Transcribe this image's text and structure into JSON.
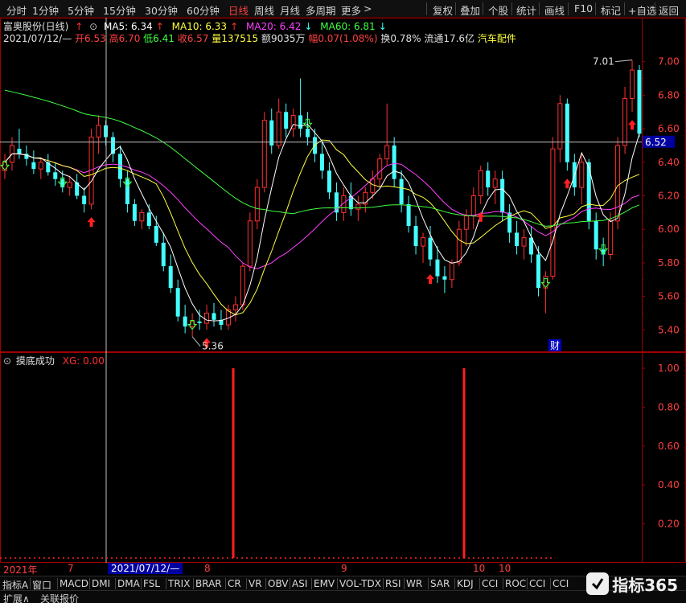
{
  "colors": {
    "up": "#ff3030",
    "down": "#44ffff",
    "ma5": "#ffffff",
    "ma10": "#ffff40",
    "ma20": "#ff40ff",
    "ma60": "#40ff40",
    "axis": "#a00000",
    "signal": "#ff2020"
  },
  "toolbar": {
    "periods": [
      "分时",
      "1分钟",
      "5分钟",
      "15分钟",
      "30分钟",
      "60分钟",
      "日线",
      "周线",
      "月线",
      "多周期",
      "更多"
    ],
    "active_period": "日线",
    "buttons": [
      "复权",
      "叠加",
      "个股",
      "统计",
      "画线",
      "F10",
      "标记",
      "+自选",
      "返回"
    ]
  },
  "main": {
    "stock_title": "富奥股份(日线)",
    "ma5_label": "MA5: 6.34",
    "ma10_label": "MA10: 6.33",
    "ma20_label": "MA20: 6.42",
    "ma60_label": "MA60: 6.81",
    "date": "2021/07/12/—",
    "open": "开6.53",
    "high": "高6.70",
    "low": "低6.41",
    "close": "收6.57",
    "volume": "量137515",
    "amount": "额9035万",
    "change": "幅0.07(1.08%)",
    "turnover": "换0.78%",
    "float_cap": "流通17.6亿",
    "sector": "汽车配件",
    "high_mark": "7.01",
    "low_mark": "5.36",
    "current_price": "6.52",
    "cai_badge": "财",
    "y_ticks": [
      "7.00",
      "6.80",
      "6.60",
      "6.40",
      "6.20",
      "6.00",
      "5.80",
      "5.60",
      "5.40"
    ]
  },
  "sub": {
    "indicator_name": "摸底成功",
    "xg_label": "XG: 0.00",
    "y_ticks": [
      "1.00",
      "0.80",
      "0.60",
      "0.40",
      "0.20",
      "0.00"
    ]
  },
  "x_axis": {
    "labels": [
      "2021年",
      "7",
      "2021/07/12/—",
      "8",
      "9",
      "10",
      "10"
    ]
  },
  "indicator_tabs": [
    "指标A",
    "窗口",
    "MACD",
    "DMI",
    "DMA",
    "FSL",
    "TRIX",
    "BRAR",
    "CR",
    "VR",
    "OBV",
    "ASI",
    "EMV",
    "VOL-TDX",
    "RSI",
    "WR",
    "SAR",
    "KDJ",
    "CCI",
    "ROC",
    "CCI",
    "CCI"
  ],
  "bottom_bar": {
    "expand": "扩展∧",
    "related": "关联报价"
  },
  "watermark": "指标365",
  "chart_data": {
    "type": "candlestick",
    "ylim": [
      5.32,
      7.08
    ],
    "candles": [
      [
        6.35,
        6.45,
        6.3,
        6.4
      ],
      [
        6.4,
        6.55,
        6.35,
        6.5
      ],
      [
        6.48,
        6.6,
        6.42,
        6.45
      ],
      [
        6.45,
        6.5,
        6.38,
        6.42
      ],
      [
        6.4,
        6.47,
        6.33,
        6.36
      ],
      [
        6.36,
        6.42,
        6.3,
        6.4
      ],
      [
        6.4,
        6.45,
        6.32,
        6.34
      ],
      [
        6.34,
        6.4,
        6.26,
        6.3
      ],
      [
        6.3,
        6.35,
        6.22,
        6.25
      ],
      [
        6.25,
        6.32,
        6.2,
        6.28
      ],
      [
        6.28,
        6.33,
        6.18,
        6.2
      ],
      [
        6.2,
        6.25,
        6.1,
        6.15
      ],
      [
        6.15,
        6.6,
        6.12,
        6.55
      ],
      [
        6.55,
        6.68,
        6.45,
        6.62
      ],
      [
        6.62,
        6.65,
        6.5,
        6.55
      ],
      [
        6.55,
        6.58,
        6.4,
        6.45
      ],
      [
        6.45,
        6.5,
        6.25,
        6.3
      ],
      [
        6.3,
        6.35,
        6.1,
        6.15
      ],
      [
        6.15,
        6.18,
        6.02,
        6.05
      ],
      [
        6.05,
        6.12,
        6.0,
        6.1
      ],
      [
        6.1,
        6.15,
        6.0,
        6.02
      ],
      [
        6.02,
        6.08,
        5.9,
        5.92
      ],
      [
        5.92,
        5.98,
        5.75,
        5.78
      ],
      [
        5.78,
        5.85,
        5.62,
        5.65
      ],
      [
        5.65,
        5.7,
        5.45,
        5.48
      ],
      [
        5.48,
        5.55,
        5.38,
        5.42
      ],
      [
        5.42,
        5.5,
        5.36,
        5.45
      ],
      [
        5.45,
        5.52,
        5.4,
        5.44
      ],
      [
        5.44,
        5.55,
        5.4,
        5.5
      ],
      [
        5.5,
        5.56,
        5.42,
        5.46
      ],
      [
        5.46,
        5.52,
        5.4,
        5.43
      ],
      [
        5.43,
        5.55,
        5.4,
        5.52
      ],
      [
        5.52,
        5.6,
        5.45,
        5.55
      ],
      [
        5.55,
        5.8,
        5.52,
        5.78
      ],
      [
        5.78,
        6.1,
        5.75,
        6.05
      ],
      [
        6.05,
        6.3,
        6.0,
        6.25
      ],
      [
        6.25,
        6.7,
        6.22,
        6.65
      ],
      [
        6.65,
        6.72,
        6.45,
        6.5
      ],
      [
        6.5,
        6.78,
        6.48,
        6.7
      ],
      [
        6.7,
        6.75,
        6.55,
        6.6
      ],
      [
        6.6,
        6.72,
        6.55,
        6.68
      ],
      [
        6.68,
        6.9,
        6.55,
        6.6
      ],
      [
        6.6,
        6.7,
        6.5,
        6.55
      ],
      [
        6.55,
        6.6,
        6.4,
        6.45
      ],
      [
        6.45,
        6.52,
        6.3,
        6.35
      ],
      [
        6.35,
        6.4,
        6.18,
        6.22
      ],
      [
        6.22,
        6.28,
        6.05,
        6.1
      ],
      [
        6.1,
        6.25,
        6.05,
        6.2
      ],
      [
        6.2,
        6.28,
        6.08,
        6.12
      ],
      [
        6.12,
        6.2,
        6.05,
        6.15
      ],
      [
        6.15,
        6.25,
        6.1,
        6.22
      ],
      [
        6.22,
        6.35,
        6.18,
        6.3
      ],
      [
        6.3,
        6.45,
        6.25,
        6.42
      ],
      [
        6.42,
        6.75,
        6.38,
        6.5
      ],
      [
        6.5,
        6.55,
        6.25,
        6.3
      ],
      [
        6.3,
        6.35,
        6.1,
        6.15
      ],
      [
        6.15,
        6.2,
        5.98,
        6.02
      ],
      [
        6.02,
        6.08,
        5.85,
        5.9
      ],
      [
        5.9,
        5.98,
        5.8,
        5.95
      ],
      [
        5.95,
        6.02,
        5.78,
        5.82
      ],
      [
        5.82,
        5.9,
        5.68,
        5.72
      ],
      [
        5.72,
        5.78,
        5.62,
        5.7
      ],
      [
        5.7,
        5.82,
        5.65,
        5.8
      ],
      [
        5.8,
        6.05,
        5.78,
        6.0
      ],
      [
        6.0,
        6.12,
        5.9,
        6.08
      ],
      [
        6.08,
        6.25,
        6.0,
        6.2
      ],
      [
        6.2,
        6.38,
        6.15,
        6.35
      ],
      [
        6.35,
        6.4,
        6.2,
        6.25
      ],
      [
        6.25,
        6.35,
        6.15,
        6.3
      ],
      [
        6.3,
        6.35,
        6.05,
        6.1
      ],
      [
        6.1,
        6.15,
        5.92,
        5.98
      ],
      [
        5.98,
        6.05,
        5.85,
        5.9
      ],
      [
        5.9,
        6.0,
        5.82,
        5.95
      ],
      [
        5.95,
        6.02,
        5.8,
        5.85
      ],
      [
        5.85,
        5.9,
        5.6,
        5.65
      ],
      [
        5.65,
        5.75,
        5.5,
        5.72
      ],
      [
        5.72,
        6.55,
        5.7,
        6.48
      ],
      [
        6.48,
        6.8,
        6.4,
        6.75
      ],
      [
        6.75,
        6.78,
        6.35,
        6.4
      ],
      [
        6.4,
        6.45,
        6.2,
        6.25
      ],
      [
        6.25,
        6.45,
        6.15,
        6.4
      ],
      [
        6.4,
        6.42,
        6.0,
        6.05
      ],
      [
        6.05,
        6.1,
        5.82,
        5.88
      ],
      [
        5.88,
        5.95,
        5.78,
        5.85
      ],
      [
        5.85,
        6.1,
        5.82,
        6.05
      ],
      [
        6.05,
        6.55,
        6.0,
        6.5
      ],
      [
        6.5,
        6.85,
        6.45,
        6.78
      ],
      [
        6.78,
        7.01,
        6.7,
        6.95
      ],
      [
        6.95,
        6.98,
        6.55,
        6.57
      ]
    ],
    "up_signals": [
      12,
      28,
      59,
      66,
      78,
      87
    ],
    "down_signals": [
      0,
      8,
      17,
      26,
      42,
      75,
      83
    ],
    "xg_signals": [
      33,
      63
    ]
  }
}
